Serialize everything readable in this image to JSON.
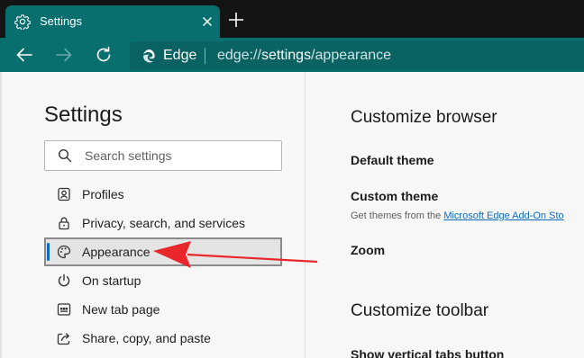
{
  "window": {
    "tab_title": "Settings",
    "tab_icon": "gear-icon",
    "close_icon": "close-icon",
    "new_tab_icon": "plus-icon"
  },
  "toolbar": {
    "back_icon": "back-arrow-icon",
    "forward_icon": "forward-arrow-icon",
    "refresh_icon": "refresh-icon",
    "browser_label": "Edge",
    "url_scheme": "edge://",
    "url_host": "settings",
    "url_path": "/appearance"
  },
  "sidebar": {
    "title": "Settings",
    "search_placeholder": "Search settings",
    "items": [
      {
        "label": "Profiles",
        "icon": "profiles-icon"
      },
      {
        "label": "Privacy, search, and services",
        "icon": "lock-icon"
      },
      {
        "label": "Appearance",
        "icon": "palette-icon",
        "selected": true
      },
      {
        "label": "On startup",
        "icon": "power-icon"
      },
      {
        "label": "New tab page",
        "icon": "new-tab-page-icon"
      },
      {
        "label": "Share, copy, and paste",
        "icon": "share-icon"
      }
    ]
  },
  "main": {
    "section1_title": "Customize browser",
    "default_theme": "Default theme",
    "custom_theme": "Custom theme",
    "custom_theme_desc": "Get themes from the ",
    "custom_theme_link": "Microsoft Edge Add-On Sto",
    "zoom": "Zoom",
    "section2_title": "Customize toolbar",
    "vertical_tabs": "Show vertical tabs button"
  },
  "colors": {
    "accent": "#086e6e",
    "selection_bar": "#0f6cbd",
    "annotation_arrow": "#e8262b"
  }
}
